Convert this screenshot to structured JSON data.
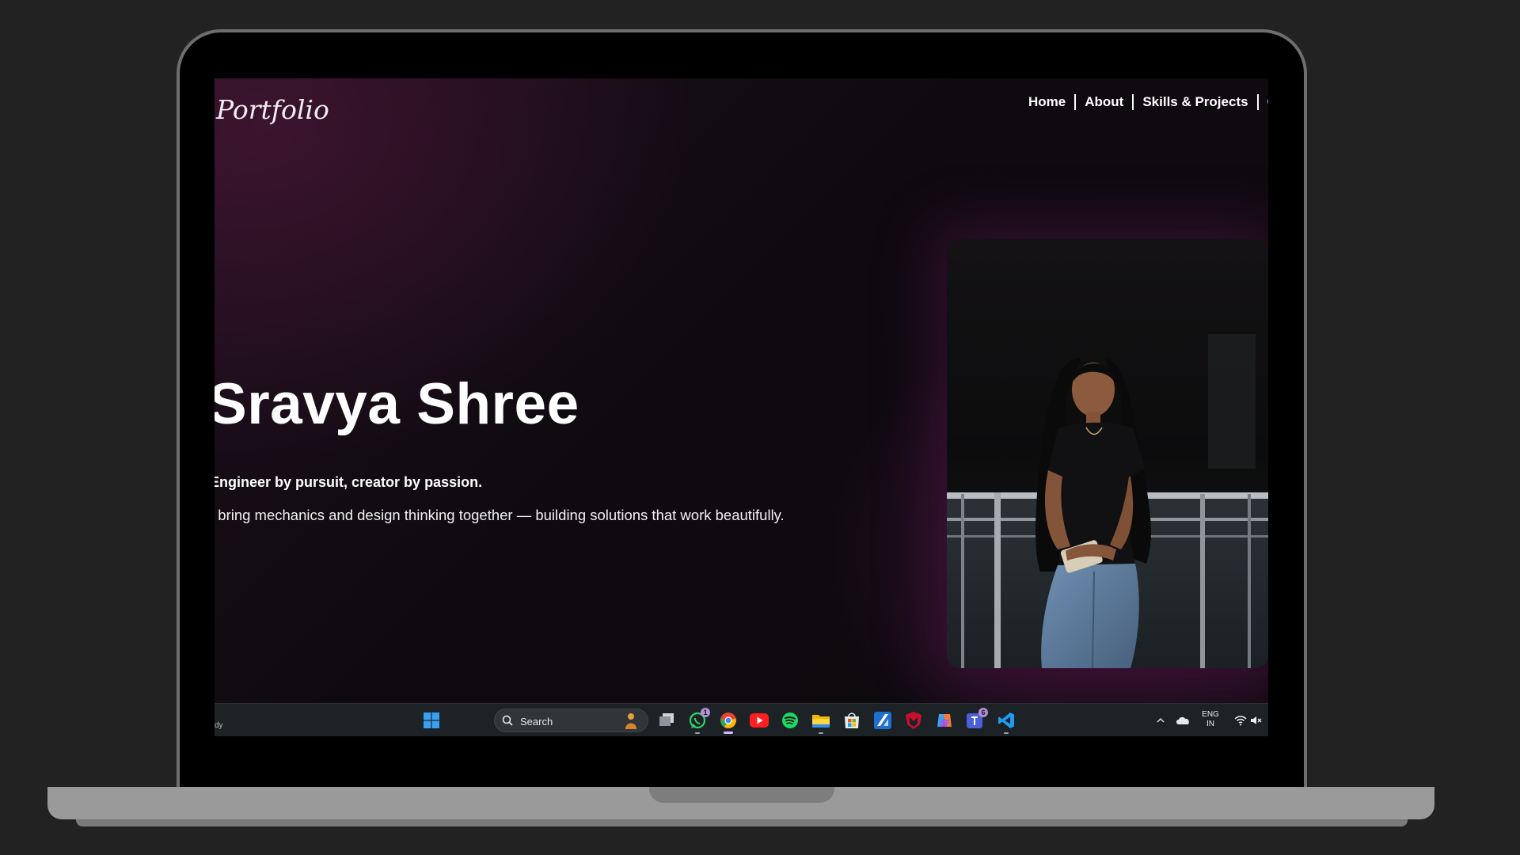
{
  "site": {
    "logo": "Portfolio",
    "nav": [
      "Home",
      "About",
      "Skills & Projects",
      "Co"
    ],
    "hero": {
      "name": "Sravya Shree",
      "tagline": "Engineer by pursuit, creator by passion.",
      "description": "I bring mechanics and design thinking together — building solutions that work beautifully."
    }
  },
  "taskbar": {
    "left_text": "dy",
    "search_placeholder": "Search",
    "apps": [
      {
        "icon": "windows-start-icon"
      },
      {
        "icon": "task-view-icon"
      },
      {
        "icon": "whatsapp-icon",
        "badge": "1"
      },
      {
        "icon": "chrome-icon"
      },
      {
        "icon": "youtube-icon"
      },
      {
        "icon": "spotify-icon"
      },
      {
        "icon": "file-explorer-icon"
      },
      {
        "icon": "microsoft-store-icon"
      },
      {
        "icon": "autodesk-icon"
      },
      {
        "icon": "mcafee-icon"
      },
      {
        "icon": "copilot-icon"
      },
      {
        "icon": "teams-icon",
        "badge": "6"
      },
      {
        "icon": "vscode-icon"
      }
    ],
    "tray": {
      "lang_line1": "ENG",
      "lang_line2": "IN"
    }
  },
  "colors": {
    "desk": "#222222",
    "site_bg": "#0d0910",
    "accent_glow": "#5f1a52",
    "taskbar": "#1d2226",
    "text": "#ffffff"
  }
}
